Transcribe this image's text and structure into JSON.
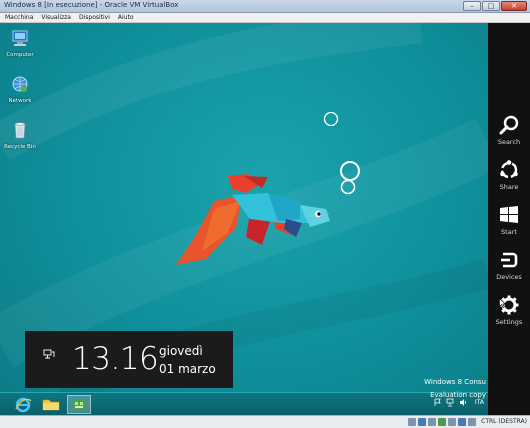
{
  "window": {
    "title": "Windows 8 [In esecuzione] - Oracle VM VirtualBox",
    "minimize": "–",
    "maximize": "□",
    "close": "✕"
  },
  "menubar": {
    "items": [
      "Macchina",
      "Visualizza",
      "Dispositivi",
      "Aiuto"
    ]
  },
  "desktop": {
    "icons": [
      {
        "label": "Computer",
        "icon": "computer-icon"
      },
      {
        "label": "Network",
        "icon": "network-icon"
      },
      {
        "label": "Recycle Bin",
        "icon": "recycle-bin-icon"
      }
    ],
    "wallpaper": "betta-fish",
    "accent": "#129aa5"
  },
  "clock": {
    "time": "13.16",
    "day": "giovedì",
    "date": "01 marzo",
    "icon": "network-status-icon"
  },
  "watermark": {
    "line1": "Windows 8 Consu",
    "line2": "Evaluation copy"
  },
  "taskbar": {
    "buttons": [
      {
        "name": "internet-explorer",
        "icon": "internet-explorer-icon",
        "active": false
      },
      {
        "name": "file-explorer",
        "icon": "folder-icon",
        "active": false
      },
      {
        "name": "app",
        "icon": "store-app-icon",
        "active": true
      }
    ],
    "tray": {
      "language": "ITA",
      "icons": [
        "flag-icon",
        "network-icon",
        "volume-icon"
      ]
    }
  },
  "charms": [
    {
      "label": "Search",
      "icon": "search-icon"
    },
    {
      "label": "Share",
      "icon": "share-icon"
    },
    {
      "label": "Start",
      "icon": "windows-logo-icon"
    },
    {
      "label": "Devices",
      "icon": "devices-icon"
    },
    {
      "label": "Settings",
      "icon": "gear-icon"
    }
  ],
  "statusbar": {
    "host_key": "CTRL (DESTRA)"
  }
}
